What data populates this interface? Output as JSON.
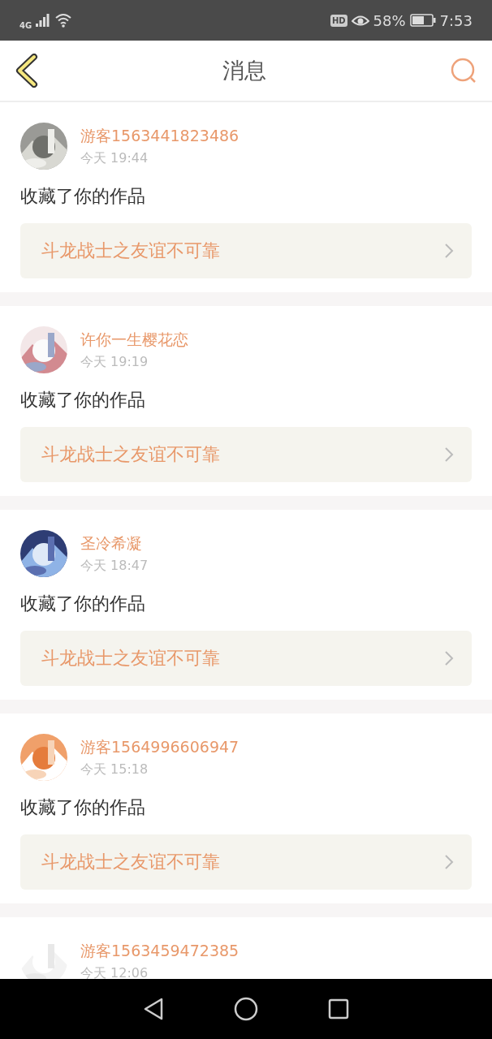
{
  "status_bar": {
    "network": "4G",
    "hd_badge": "HD",
    "battery": "58%",
    "time": "7:53"
  },
  "header": {
    "title": "消息"
  },
  "messages": [
    {
      "name": "游客1563441823486",
      "time": "今天 19:44",
      "action": "收藏了你的作品",
      "work": "斗龙战士之友谊不可靠"
    },
    {
      "name": "许你一生樱花恋",
      "time": "今天 19:19",
      "action": "收藏了你的作品",
      "work": "斗龙战士之友谊不可靠"
    },
    {
      "name": "圣冷希凝",
      "time": "今天 18:47",
      "action": "收藏了你的作品",
      "work": "斗龙战士之友谊不可靠"
    },
    {
      "name": "游客1564996606947",
      "time": "今天 15:18",
      "action": "收藏了你的作品",
      "work": "斗龙战士之友谊不可靠"
    },
    {
      "name": "游客1563459472385",
      "time": "今天 12:06"
    }
  ]
}
